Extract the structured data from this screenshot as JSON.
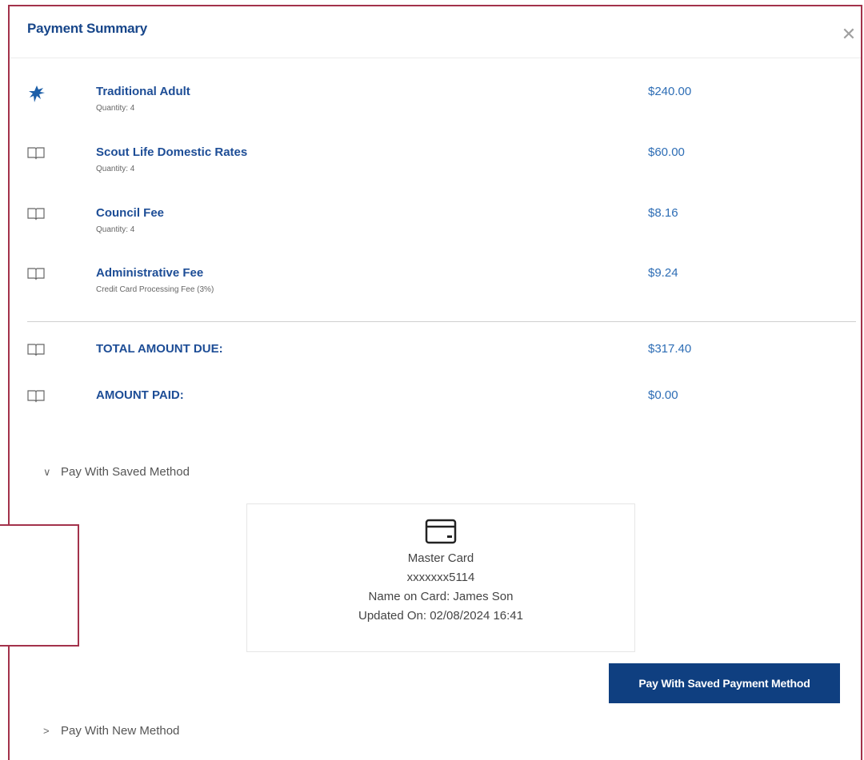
{
  "modal": {
    "title": "Payment Summary",
    "close_icon": "close-icon"
  },
  "line_items": [
    {
      "icon": "scout-emblem-icon",
      "name": "Traditional Adult",
      "sub": "Quantity: 4",
      "price": "$240.00"
    },
    {
      "icon": "book-icon",
      "name": "Scout Life Domestic Rates",
      "sub": "Quantity: 4",
      "price": "$60.00"
    },
    {
      "icon": "book-icon",
      "name": "Council Fee",
      "sub": "Quantity: 4",
      "price": "$8.16"
    },
    {
      "icon": "book-icon",
      "name": "Administrative Fee",
      "sub": "Credit Card Processing Fee (3%)",
      "price": "$9.24"
    }
  ],
  "totals": [
    {
      "icon": "book-icon",
      "label": "TOTAL AMOUNT DUE:",
      "value": "$317.40"
    },
    {
      "icon": "book-icon",
      "label": "AMOUNT PAID:",
      "value": "$0.00"
    }
  ],
  "saved_method": {
    "toggle_label": "Pay With Saved Method",
    "expanded": true,
    "card": {
      "icon": "credit-card-icon",
      "brand": "Master Card",
      "number": "xxxxxxx5114",
      "name_on_card": "Name on Card: James Son",
      "updated_on": "Updated On: 02/08/2024 16:41"
    },
    "pay_button_label": "Pay With Saved Payment Method"
  },
  "new_method": {
    "toggle_label": "Pay With New Method",
    "expanded": false
  },
  "colors": {
    "title": "#17468a",
    "item_name": "#1d4d96",
    "price": "#2d6db5",
    "button_bg": "#0f3f80",
    "frame": "#a3324b"
  }
}
